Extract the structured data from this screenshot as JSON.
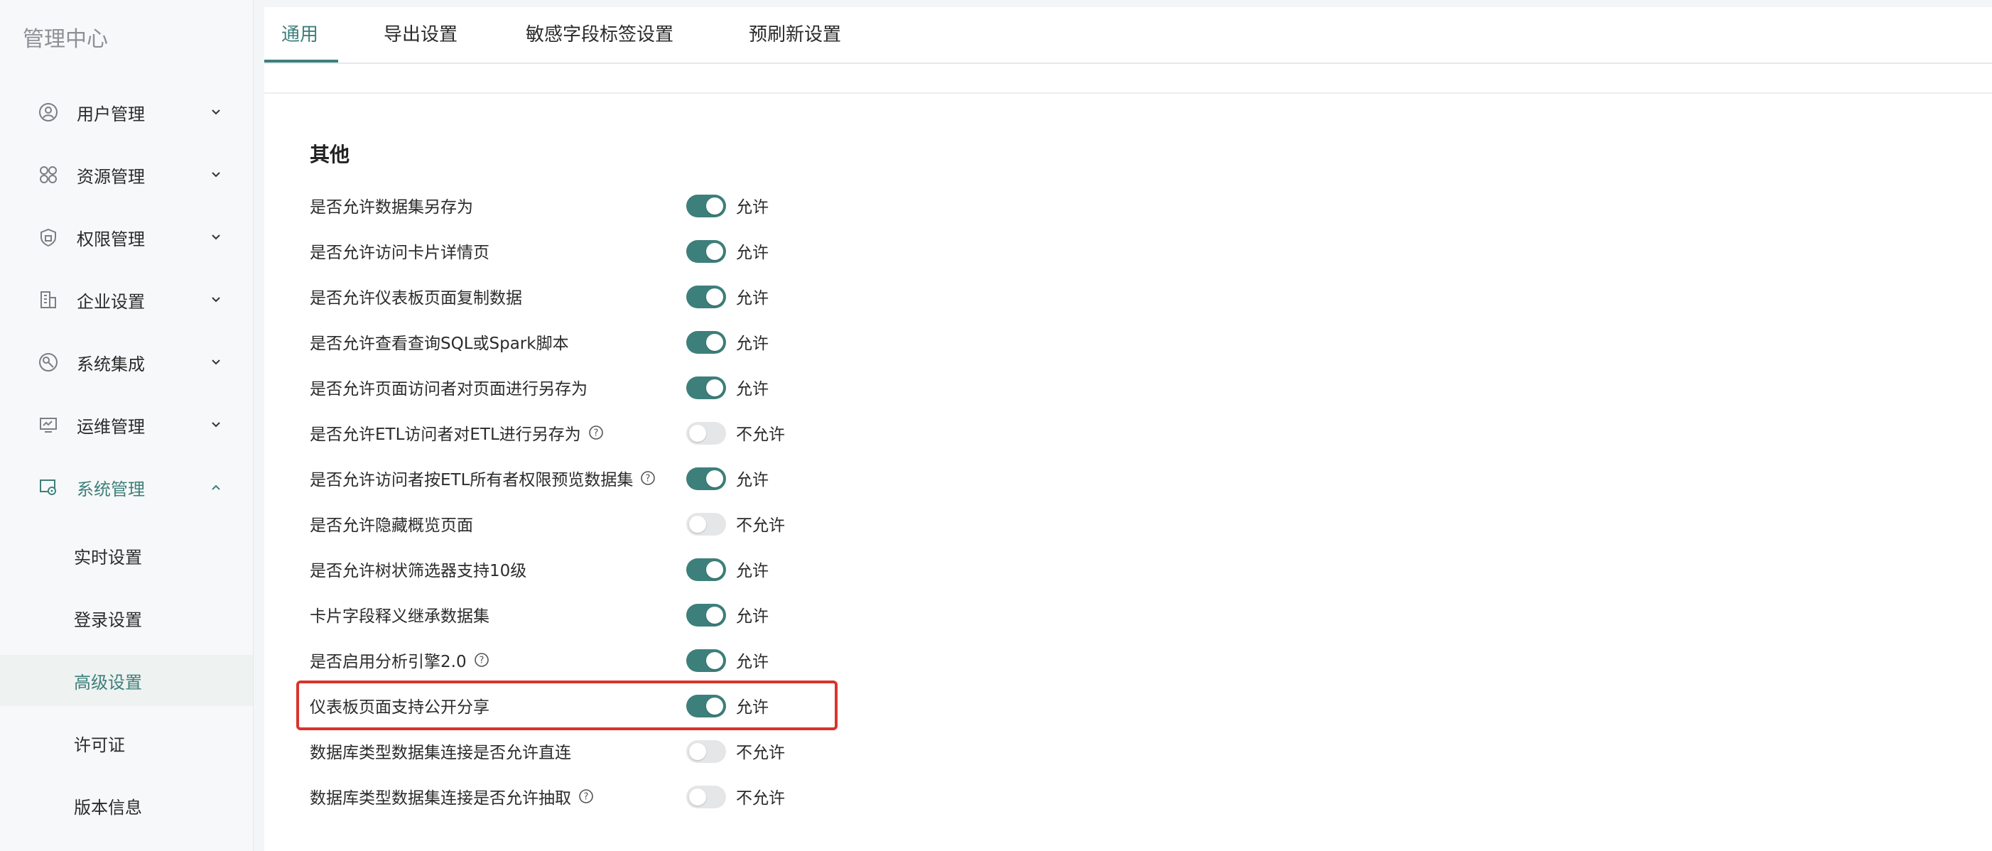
{
  "sidebar": {
    "brand": "管理中心",
    "items": [
      {
        "label": "用户管理",
        "icon": "user-icon"
      },
      {
        "label": "资源管理",
        "icon": "grid-icon"
      },
      {
        "label": "权限管理",
        "icon": "shield-icon"
      },
      {
        "label": "企业设置",
        "icon": "building-icon"
      },
      {
        "label": "系统集成",
        "icon": "link-icon"
      },
      {
        "label": "运维管理",
        "icon": "monitor-icon"
      },
      {
        "label": "系统管理",
        "icon": "settings-icon"
      }
    ],
    "sub_items": [
      {
        "label": "实时设置"
      },
      {
        "label": "登录设置"
      },
      {
        "label": "高级设置"
      },
      {
        "label": "许可证"
      },
      {
        "label": "版本信息"
      }
    ]
  },
  "tabs": [
    {
      "label": "通用"
    },
    {
      "label": "导出设置"
    },
    {
      "label": "敏感字段标签设置"
    },
    {
      "label": "预刷新设置"
    }
  ],
  "section": {
    "title": "其他"
  },
  "settings": [
    {
      "label": "是否允许数据集另存为",
      "enabled": true,
      "state": "允许",
      "help": false
    },
    {
      "label": "是否允许访问卡片详情页",
      "enabled": true,
      "state": "允许",
      "help": false
    },
    {
      "label": "是否允许仪表板页面复制数据",
      "enabled": true,
      "state": "允许",
      "help": false
    },
    {
      "label": "是否允许查看查询SQL或Spark脚本",
      "enabled": true,
      "state": "允许",
      "help": false
    },
    {
      "label": "是否允许页面访问者对页面进行另存为",
      "enabled": true,
      "state": "允许",
      "help": false
    },
    {
      "label": "是否允许ETL访问者对ETL进行另存为",
      "enabled": false,
      "state": "不允许",
      "help": true
    },
    {
      "label": "是否允许访问者按ETL所有者权限预览数据集",
      "enabled": true,
      "state": "允许",
      "help": true
    },
    {
      "label": "是否允许隐藏概览页面",
      "enabled": false,
      "state": "不允许",
      "help": false
    },
    {
      "label": "是否允许树状筛选器支持10级",
      "enabled": true,
      "state": "允许",
      "help": false
    },
    {
      "label": "卡片字段释义继承数据集",
      "enabled": true,
      "state": "允许",
      "help": false
    },
    {
      "label": "是否启用分析引擎2.0",
      "enabled": true,
      "state": "允许",
      "help": true
    },
    {
      "label": "仪表板页面支持公开分享",
      "enabled": true,
      "state": "允许",
      "help": false
    },
    {
      "label": "数据库类型数据集连接是否允许直连",
      "enabled": false,
      "state": "不允许",
      "help": false
    },
    {
      "label": "数据库类型数据集连接是否允许抽取",
      "enabled": false,
      "state": "不允许",
      "help": true
    }
  ],
  "colors": {
    "accent": "#3d7f7b",
    "highlight": "#d9342b"
  }
}
